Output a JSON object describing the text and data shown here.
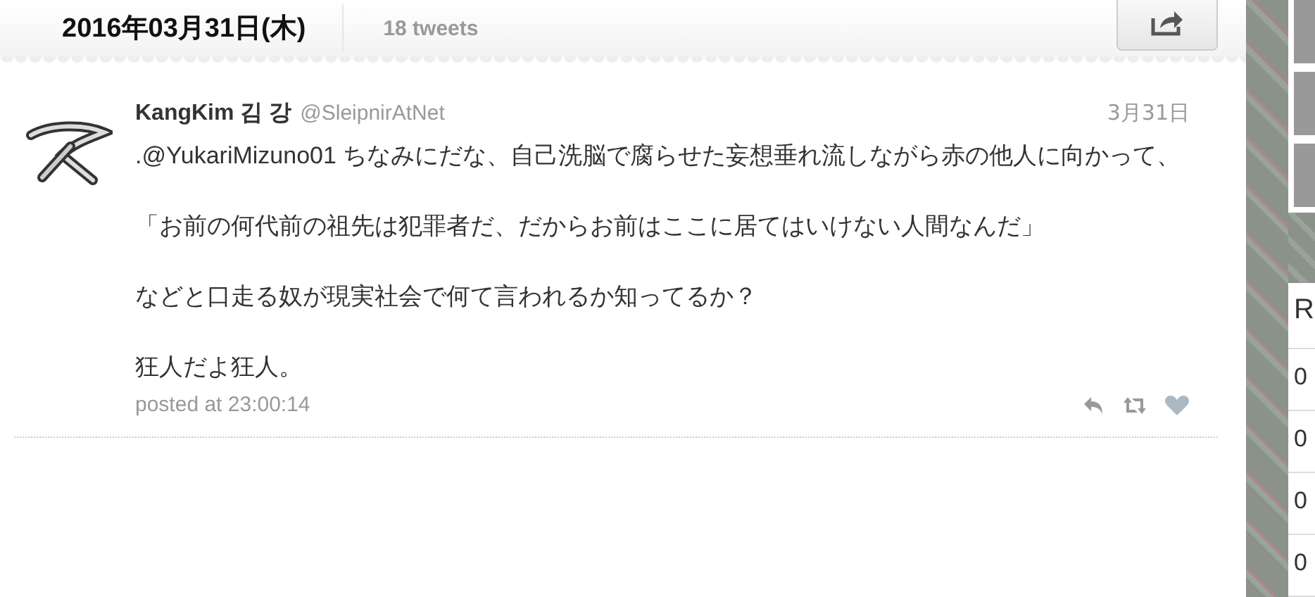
{
  "header": {
    "date": "2016年03月31日(木)",
    "count": "18 tweets"
  },
  "tweets": [
    {
      "name": "KangKim 김 강",
      "handle": "@SleipnirAtNet",
      "date": "3月31日",
      "paragraphs": [
        ".@YukariMizuno01 ちなみにだな、自己洗脳で腐らせた妄想垂れ流しながら赤の他人に向かって、",
        "「お前の何代前の祖先は犯罪者だ、だからお前はここに居てはいけない人間なんだ」",
        "などと口走る奴が現実社会で何て言われるか知ってるか？",
        "狂人だよ狂人。"
      ],
      "posted": "posted at 23:00:14",
      "liked": false
    }
  ],
  "sidebar": {
    "heading": "R",
    "rows": [
      "0",
      "0",
      "0",
      "0"
    ]
  }
}
